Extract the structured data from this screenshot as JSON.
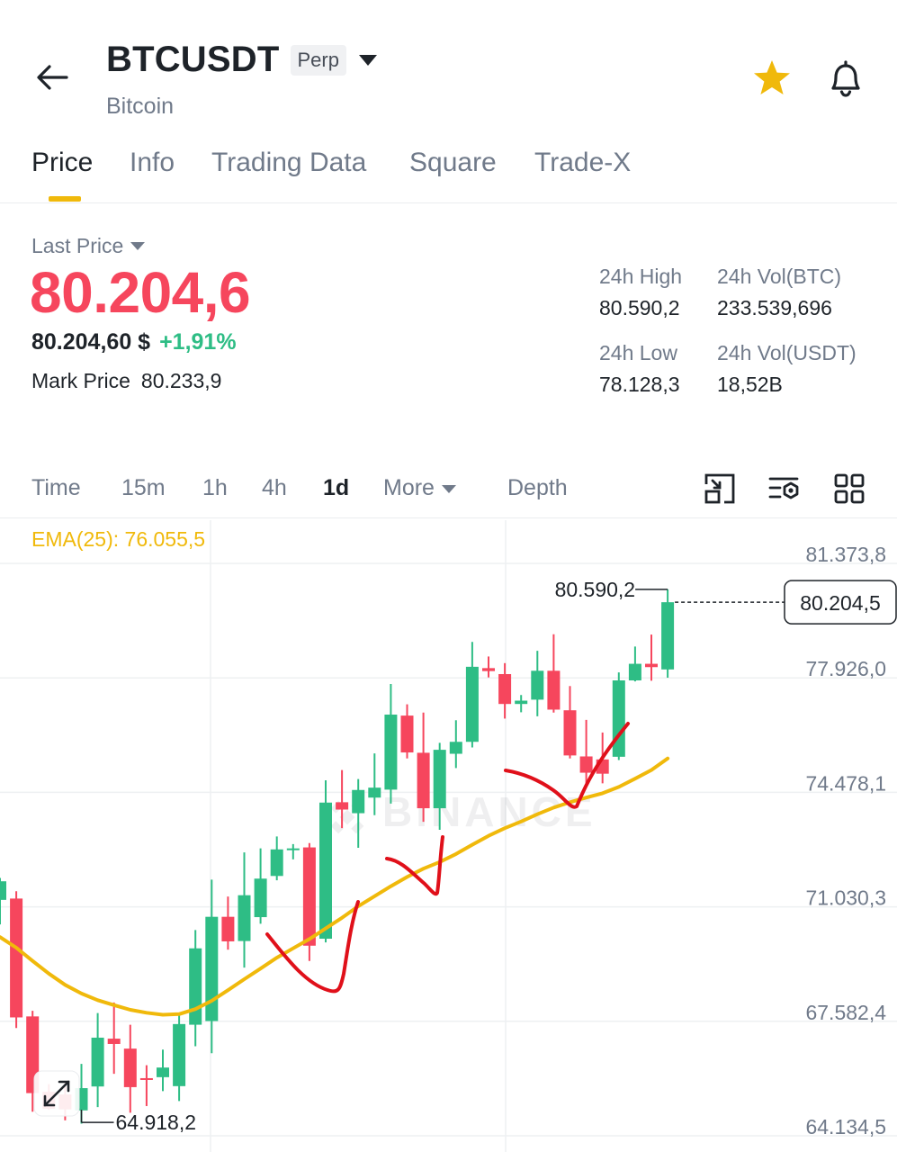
{
  "header": {
    "symbol": "BTCUSDT",
    "badge": "Perp",
    "coin_name": "Bitcoin"
  },
  "tabs": [
    {
      "label": "Price",
      "active": true
    },
    {
      "label": "Info",
      "active": false
    },
    {
      "label": "Trading Data",
      "active": false
    },
    {
      "label": "Square",
      "active": false
    },
    {
      "label": "Trade-X",
      "active": false
    }
  ],
  "ticker": {
    "last_price_label": "Last Price",
    "last_price": "80.204,6",
    "usd_price": "80.204,60 $",
    "change_pct": "+1,91%",
    "mark_price_label": "Mark Price",
    "mark_price": "80.233,9",
    "high_label": "24h High",
    "high_value": "80.590,2",
    "low_label": "24h Low",
    "low_value": "78.128,3",
    "vol_btc_label": "24h Vol(BTC)",
    "vol_btc_value": "233.539,696",
    "vol_usdt_label": "24h Vol(USDT)",
    "vol_usdt_value": "18,52B"
  },
  "toolbar": {
    "time_label": "Time",
    "intervals": [
      "15m",
      "1h",
      "4h",
      "1d"
    ],
    "active_interval": "1d",
    "more_label": "More",
    "depth_label": "Depth",
    "icons": [
      "fullscreen-exit-icon",
      "indicator-settings-icon",
      "grid-layout-icon"
    ]
  },
  "colors": {
    "up": "#2ebd85",
    "down": "#f6465d",
    "ema": "#f0b90b",
    "accent": "#f0b90b",
    "annotation": "#e0101a"
  },
  "chart_data": {
    "type": "candlestick",
    "timeframe": "1d",
    "indicator_label": "EMA(25): 76.055,5",
    "y_ticks": [
      "81.373,8",
      "77.926,0",
      "74.478,1",
      "71.030,3",
      "67.582,4",
      "64.134,5"
    ],
    "y_range": [
      64134.5,
      81373.8
    ],
    "grid": true,
    "watermark": "BINANCE",
    "current_price_tag": "80.204,5",
    "high_marker": {
      "label": "80.590,2",
      "value": 80590.2
    },
    "low_marker": {
      "label": "64.918,2",
      "value": 64918.2
    },
    "candles": [
      {
        "o": 71240,
        "h": 71900,
        "l": 70500,
        "c": 71800
      },
      {
        "o": 71280,
        "h": 71500,
        "l": 67380,
        "c": 67700
      },
      {
        "o": 67730,
        "h": 67900,
        "l": 64860,
        "c": 65420
      },
      {
        "o": 65460,
        "h": 65690,
        "l": 64918,
        "c": 64950
      },
      {
        "o": 65380,
        "h": 65800,
        "l": 64600,
        "c": 64930
      },
      {
        "o": 64900,
        "h": 66300,
        "l": 64500,
        "c": 65570
      },
      {
        "o": 65620,
        "h": 67830,
        "l": 65000,
        "c": 67090
      },
      {
        "o": 67060,
        "h": 68150,
        "l": 66000,
        "c": 66900
      },
      {
        "o": 66760,
        "h": 67480,
        "l": 64830,
        "c": 65600
      },
      {
        "o": 65870,
        "h": 66260,
        "l": 65030,
        "c": 65850
      },
      {
        "o": 65900,
        "h": 66730,
        "l": 65480,
        "c": 66190
      },
      {
        "o": 65630,
        "h": 67780,
        "l": 65180,
        "c": 67500
      },
      {
        "o": 67480,
        "h": 70330,
        "l": 66830,
        "c": 69780
      },
      {
        "o": 67590,
        "h": 71850,
        "l": 66620,
        "c": 70730
      },
      {
        "o": 70730,
        "h": 71340,
        "l": 69740,
        "c": 69990
      },
      {
        "o": 70000,
        "h": 72670,
        "l": 69200,
        "c": 71380
      },
      {
        "o": 70720,
        "h": 72790,
        "l": 70520,
        "c": 71880
      },
      {
        "o": 71960,
        "h": 73150,
        "l": 71830,
        "c": 72760
      },
      {
        "o": 72740,
        "h": 72920,
        "l": 72460,
        "c": 72790
      },
      {
        "o": 72820,
        "h": 72950,
        "l": 69400,
        "c": 69860
      },
      {
        "o": 70070,
        "h": 74840,
        "l": 69960,
        "c": 74170
      },
      {
        "o": 74180,
        "h": 75150,
        "l": 73400,
        "c": 73960
      },
      {
        "o": 73850,
        "h": 74880,
        "l": 72810,
        "c": 74550
      },
      {
        "o": 74320,
        "h": 75650,
        "l": 73790,
        "c": 74620
      },
      {
        "o": 74560,
        "h": 77740,
        "l": 74140,
        "c": 76820
      },
      {
        "o": 76790,
        "h": 77130,
        "l": 75500,
        "c": 75680
      },
      {
        "o": 75670,
        "h": 76880,
        "l": 73590,
        "c": 74000
      },
      {
        "o": 74000,
        "h": 75970,
        "l": 73350,
        "c": 75760
      },
      {
        "o": 75640,
        "h": 76650,
        "l": 75210,
        "c": 76000
      },
      {
        "o": 76000,
        "h": 79010,
        "l": 75830,
        "c": 78260
      },
      {
        "o": 78220,
        "h": 78570,
        "l": 77940,
        "c": 78130
      },
      {
        "o": 78040,
        "h": 78370,
        "l": 76700,
        "c": 77140
      },
      {
        "o": 77140,
        "h": 77410,
        "l": 76890,
        "c": 77240
      },
      {
        "o": 77270,
        "h": 78740,
        "l": 76770,
        "c": 78140
      },
      {
        "o": 78140,
        "h": 79240,
        "l": 76880,
        "c": 76970
      },
      {
        "o": 76950,
        "h": 77680,
        "l": 75500,
        "c": 75590
      },
      {
        "o": 75560,
        "h": 76660,
        "l": 74640,
        "c": 75070
      },
      {
        "o": 75470,
        "h": 76280,
        "l": 74750,
        "c": 75040
      },
      {
        "o": 75550,
        "h": 78090,
        "l": 75450,
        "c": 77850
      },
      {
        "o": 77850,
        "h": 78870,
        "l": 77820,
        "c": 78350
      },
      {
        "o": 78350,
        "h": 79230,
        "l": 77840,
        "c": 78250
      },
      {
        "o": 78180,
        "h": 80590,
        "l": 77930,
        "c": 80204.5
      }
    ],
    "ema": [
      70120,
      69800,
      69400,
      69020,
      68680,
      68420,
      68220,
      68070,
      67930,
      67840,
      67780,
      67800,
      67950,
      68200,
      68520,
      68850,
      69170,
      69500,
      69780,
      70060,
      70380,
      70700,
      71050,
      71350,
      71650,
      71930,
      72180,
      72380,
      72620,
      72900,
      73170,
      73400,
      73600,
      73820,
      74020,
      74180,
      74320,
      74450,
      74640,
      74890,
      75150,
      75500
    ]
  }
}
